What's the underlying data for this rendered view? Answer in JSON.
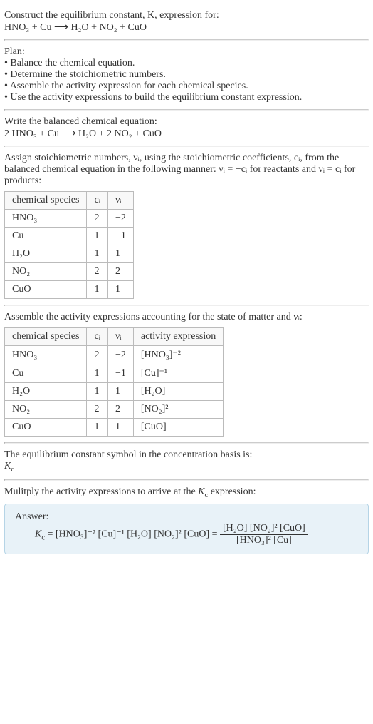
{
  "title_line1": "Construct the equilibrium constant, K, expression for:",
  "title_line2": "HNO₃ + Cu ⟶ H₂O + NO₂ + CuO",
  "plan_heading": "Plan:",
  "plan_items": [
    "• Balance the chemical equation.",
    "• Determine the stoichiometric numbers.",
    "• Assemble the activity expression for each chemical species.",
    "• Use the activity expressions to build the equilibrium constant expression."
  ],
  "balanced_heading": "Write the balanced chemical equation:",
  "balanced_eq": "2 HNO₃ + Cu ⟶ H₂O + 2 NO₂ + CuO",
  "assign_text": "Assign stoichiometric numbers, νᵢ, using the stoichiometric coefficients, cᵢ, from the balanced chemical equation in the following manner: νᵢ = −cᵢ for reactants and νᵢ = cᵢ for products:",
  "table1": {
    "headers": [
      "chemical species",
      "cᵢ",
      "νᵢ"
    ],
    "rows": [
      [
        "HNO₃",
        "2",
        "−2"
      ],
      [
        "Cu",
        "1",
        "−1"
      ],
      [
        "H₂O",
        "1",
        "1"
      ],
      [
        "NO₂",
        "2",
        "2"
      ],
      [
        "CuO",
        "1",
        "1"
      ]
    ]
  },
  "assemble_text": "Assemble the activity expressions accounting for the state of matter and νᵢ:",
  "table2": {
    "headers": [
      "chemical species",
      "cᵢ",
      "νᵢ",
      "activity expression"
    ],
    "rows": [
      [
        "HNO₃",
        "2",
        "−2",
        "[HNO₃]⁻²"
      ],
      [
        "Cu",
        "1",
        "−1",
        "[Cu]⁻¹"
      ],
      [
        "H₂O",
        "1",
        "1",
        "[H₂O]"
      ],
      [
        "NO₂",
        "2",
        "2",
        "[NO₂]²"
      ],
      [
        "CuO",
        "1",
        "1",
        "[CuO]"
      ]
    ]
  },
  "symbol_text": "The equilibrium constant symbol in the concentration basis is:",
  "symbol_value": "K_c",
  "multiply_text": "Mulitply the activity expressions to arrive at the K_c expression:",
  "answer_label": "Answer:",
  "answer_left": "K_c = [HNO₃]⁻² [Cu]⁻¹ [H₂O] [NO₂]² [CuO] =",
  "answer_num": "[H₂O] [NO₂]² [CuO]",
  "answer_den": "[HNO₃]² [Cu]"
}
